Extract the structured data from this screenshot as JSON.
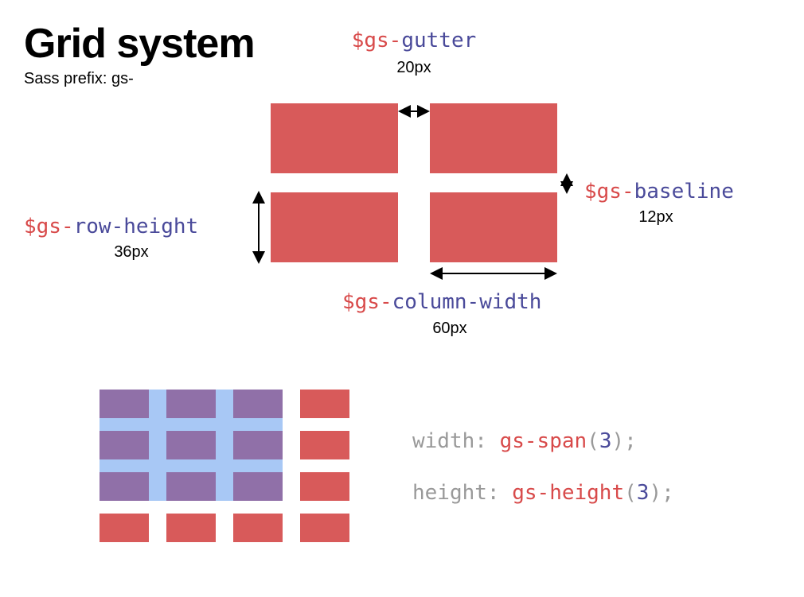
{
  "title": "Grid system",
  "subtitle": "Sass prefix: gs-",
  "vars": {
    "gutter": {
      "prefix": "$gs-",
      "name": "gutter",
      "value": "20px"
    },
    "baseline": {
      "prefix": "$gs-",
      "name": "baseline",
      "value": "12px"
    },
    "row_height": {
      "prefix": "$gs-",
      "name": "row-height",
      "value": "36px"
    },
    "column_width": {
      "prefix": "$gs-",
      "name": "column-width",
      "value": "60px"
    }
  },
  "css_lines": {
    "width": {
      "prop": "width",
      "colon": ": ",
      "fn": "gs-span",
      "open": "(",
      "arg": "3",
      "close": ");"
    },
    "height": {
      "prop": "height",
      "colon": ": ",
      "fn": "gs-height",
      "open": "(",
      "arg": "3",
      "close": ");"
    }
  }
}
